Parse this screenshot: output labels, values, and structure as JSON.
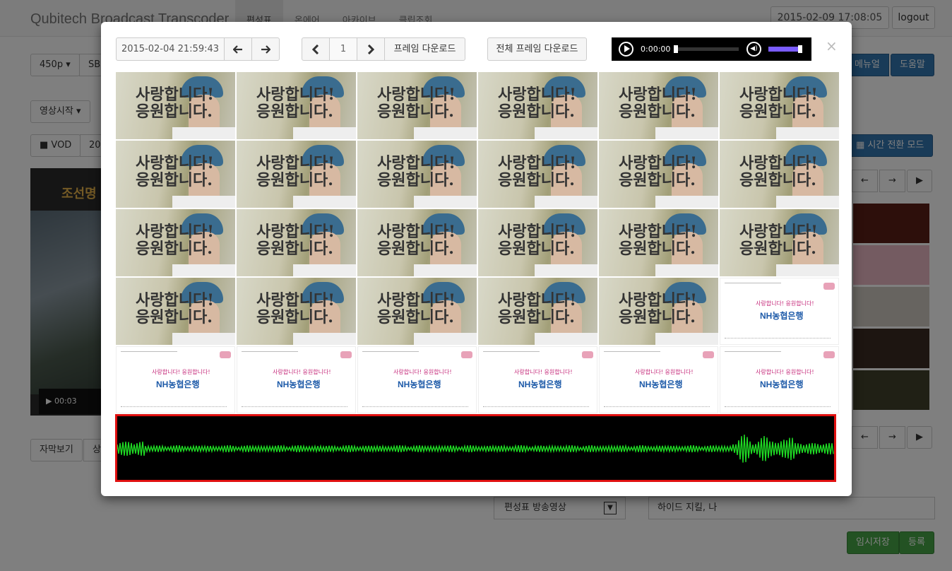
{
  "app": {
    "brand": "Qubitech Broadcast Transcoder",
    "nav_tabs": [
      "편성표",
      "온에어",
      "아카이브",
      "클립조회"
    ],
    "datetime": "2015-02-09 17:08:05",
    "logout": "logout"
  },
  "background": {
    "resolution": "450p ▾",
    "channel": "SBS",
    "video_start": "영상시작 ▾",
    "vod": "■ VOD",
    "vod_date": "20",
    "manual": "메뉴얼",
    "help": "도움말",
    "time_mode": "시간 전환 모드",
    "video_title": "조선명",
    "video_time": "00:03",
    "subtitle_view": "자막보기",
    "subtitle_extra": "상",
    "select_value": "편성표 방송영상",
    "text_value": "하이드 지킬, 나",
    "temp_save": "임시저장",
    "register": "등록",
    "arrow_left": "←",
    "arrow_right": "→",
    "play": "▶"
  },
  "modal": {
    "date": "2015-02-04 21:59:43",
    "page": "1",
    "frame_download": "프레임 다운로드",
    "all_frame_download": "전체 프레임 다운로드",
    "close": "×",
    "audio_time": "0:00:00",
    "frame_text_1": "사랑합니다!",
    "frame_text_2": "응원합니다.",
    "nh_top": "사랑합니다! 응원합니다!",
    "nh_logo": "NH농협은행",
    "frames": [
      "baseball",
      "baseball",
      "baseball",
      "baseball",
      "baseball",
      "baseball",
      "baseball",
      "baseball",
      "baseball",
      "baseball",
      "baseball",
      "baseball",
      "baseball",
      "baseball",
      "baseball",
      "baseball",
      "baseball",
      "baseball",
      "baseball",
      "baseball",
      "baseball",
      "baseball",
      "baseball",
      "nh",
      "nh",
      "nh",
      "nh",
      "nh",
      "nh",
      "nh"
    ]
  },
  "colors": {
    "waveform": "#1fdc24",
    "waveform_border": "#e01010",
    "audio_volume": "#7a5cff"
  }
}
